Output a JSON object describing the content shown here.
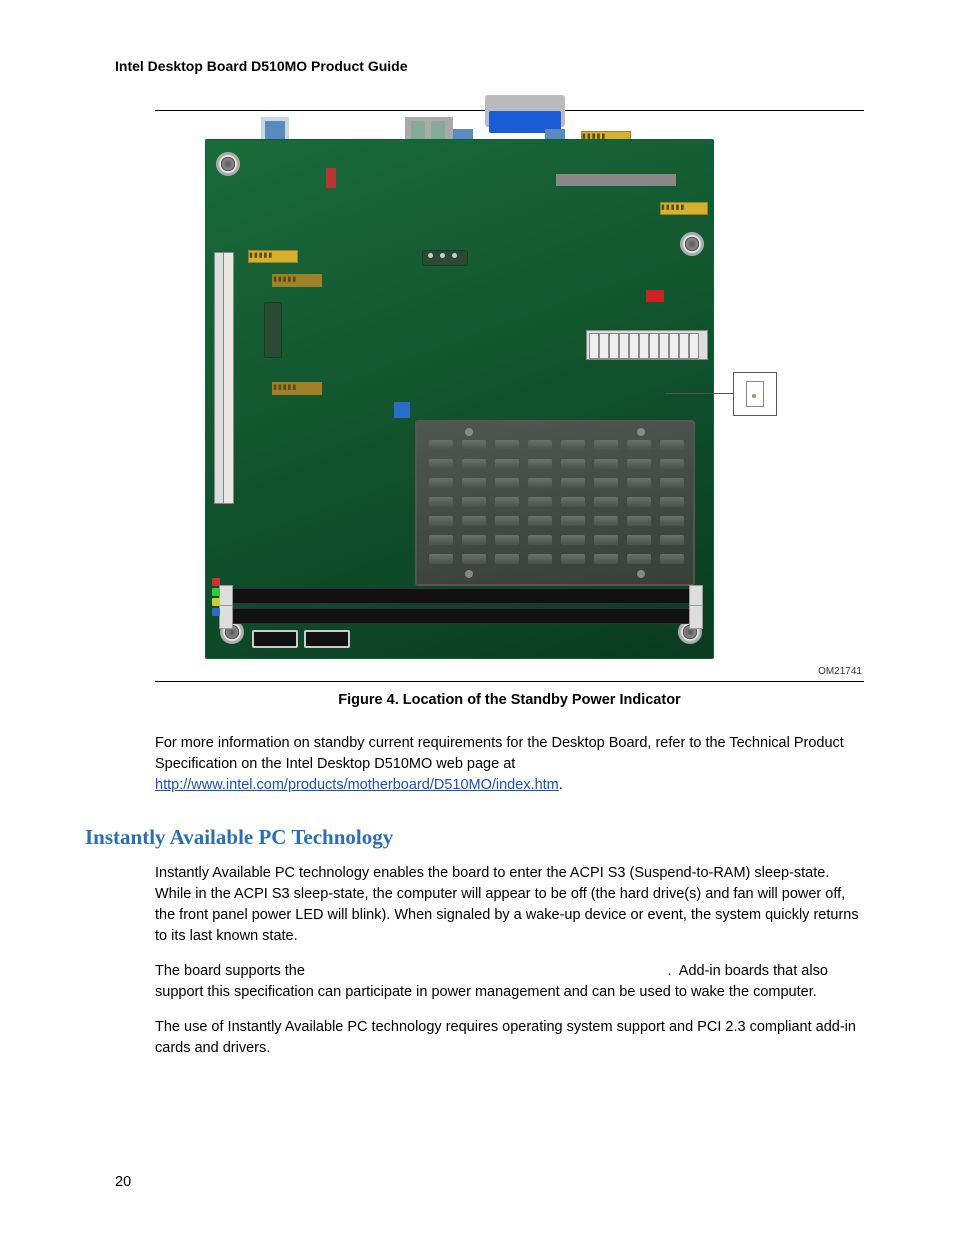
{
  "running_head": "Intel Desktop Board D510MO Product Guide",
  "figure_ref": "OM21741",
  "caption": "Figure 4.  Location of the Standby Power Indicator",
  "para1_a": "For more information on standby current requirements for the Desktop Board, refer to the Technical Product Specification on the Intel Desktop D510MO web page at ",
  "link": "http://www.intel.com/products/motherboard/D510MO/index.htm",
  "para1_b": ".",
  "section_heading": "Instantly Available PC Technology",
  "para2": "Instantly Available PC technology enables the board to enter the ACPI S3 (Suspend-to-RAM) sleep-state.  While in the ACPI S3 sleep-state, the computer will appear to be off (the hard drive(s) and fan will power off, the front panel power LED will blink).  When signaled by a wake-up device or event, the system quickly returns to its last known state.",
  "para3": "The board supports the                                                                                          .  Add-in boards that also support this specification can participate in power management and can be used to wake the computer.",
  "para4": "The use of Instantly Available PC technology requires operating system support and PCI 2.3 compliant add-in cards and drivers.",
  "page_number": "20"
}
